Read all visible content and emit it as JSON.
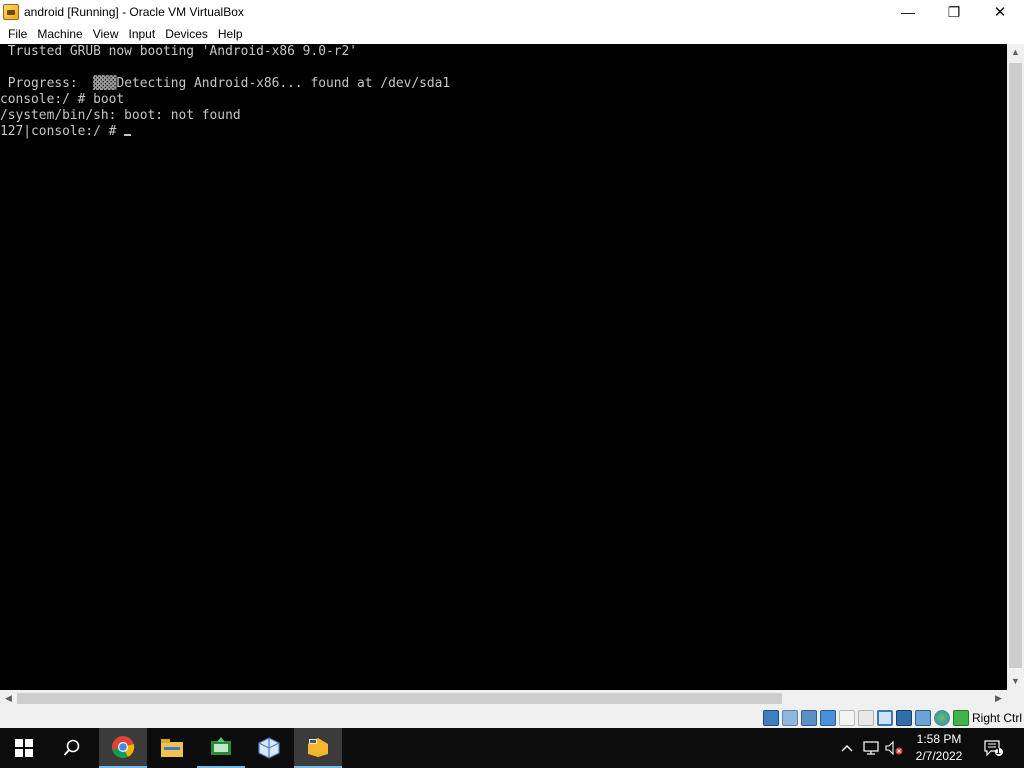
{
  "window": {
    "title": "android [Running] - Oracle VM VirtualBox",
    "minimize_glyph": "—",
    "restore_glyph": "❐",
    "close_glyph": "✕"
  },
  "menu": {
    "items": [
      "File",
      "Machine",
      "View",
      "Input",
      "Devices",
      "Help"
    ]
  },
  "console": {
    "lines": [
      " Trusted GRUB now booting 'Android-x86 9.0-r2'",
      "",
      " Progress:  ",
      "console:/ # boot",
      "/system/bin/sh: boot: not found",
      "127|console:/ # "
    ],
    "progress_bar": "▓▓▓",
    "progress_text": "Detecting Android-x86... found at /dev/sda1"
  },
  "scrollbars": {
    "up_glyph": "▲",
    "down_glyph": "▼",
    "left_glyph": "◀",
    "right_glyph": "▶"
  },
  "statusbar": {
    "host_key": "Right Ctrl",
    "icons": [
      "hard-disk-icon",
      "optical-drive-icon",
      "audio-icon",
      "network-icon",
      "usb-icon",
      "shared-folders-icon",
      "display-icon",
      "video-capture-icon",
      "vt-x-icon",
      "mouse-integration-icon",
      "keyboard-capture-icon"
    ]
  },
  "taskbar": {
    "apps": [
      "start-icon",
      "search-icon",
      "chrome-icon",
      "file-explorer-icon",
      "screen-recorder-icon",
      "virtualbox-icon",
      "virtualbox-vm-icon"
    ],
    "tray": {
      "chevron": "^",
      "time": "1:58 PM",
      "date": "2/7/2022",
      "notification_count": "1"
    }
  },
  "colors": {
    "console_bg": "#000000",
    "console_fg": "#c6c6c6",
    "taskbar_bg": "#0c0c0c",
    "active_underline": "#76b9ed"
  }
}
